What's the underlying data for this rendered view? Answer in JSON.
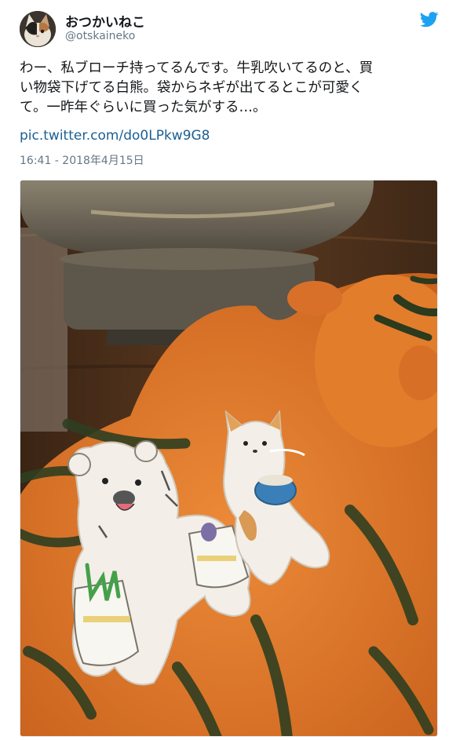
{
  "user": {
    "display_name": "おつかいねこ",
    "handle": "@otskaineko",
    "avatar_icon": "cat-avatar-icon"
  },
  "brand": {
    "logo_icon": "twitter-bird-icon",
    "color": "#1da1f2"
  },
  "tweet": {
    "lines": [
      "わー、私ブローチ持ってるんです。牛乳吹いてるのと、買",
      "い物袋下げてる白熊。袋からネギが出てるとこが可愛く",
      "て。一昨年ぐらいに買った気がする…。"
    ],
    "link": "pic.twitter.com/do0LPkw9G8",
    "timestamp": "16:41 - 2018年4月15日"
  },
  "media": {
    "subject": "embroidered brooches on felt",
    "colors": {
      "felt": "#e0782a",
      "table": "#4a2f1a",
      "bowl": "#6f6656",
      "cloth": "#f3efe8",
      "milk": "#3a7fb8",
      "onion": "#45a04a"
    }
  }
}
